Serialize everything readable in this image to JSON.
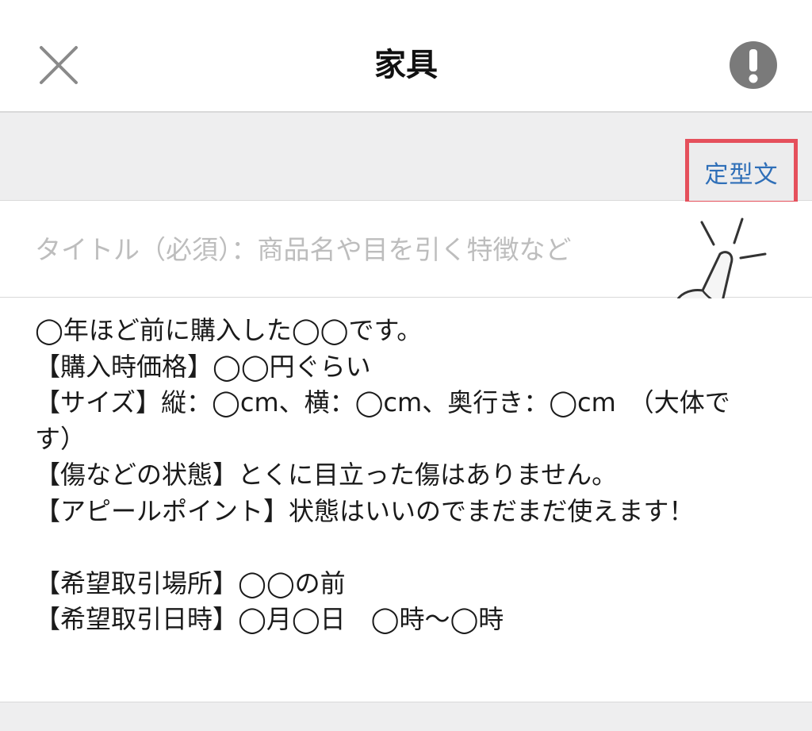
{
  "header": {
    "title": "家具",
    "close_icon": "close-icon",
    "report_icon": "exclamation-icon"
  },
  "toolbar": {
    "template_label": "定型文",
    "highlight_color": "#e5505c",
    "link_color": "#2f6fb8"
  },
  "title_field": {
    "placeholder": "タイトル（必須）：商品名や目を引く特徴など",
    "value": ""
  },
  "description": {
    "text": "◯年ほど前に購入した◯◯です。\n【購入時価格】◯◯円ぐらい\n【サイズ】縦：◯cm、横：◯cm、奥行き：◯cm　（大体です）\n【傷などの状態】とくに目立った傷はありません。\n【アピールポイント】状態はいいのでまだまだ使えます！\n\n【希望取引場所】◯◯の前\n【希望取引日時】◯月◯日　◯時〜◯時"
  },
  "decoration": {
    "pointer_icon": "pointing-hand-icon"
  }
}
